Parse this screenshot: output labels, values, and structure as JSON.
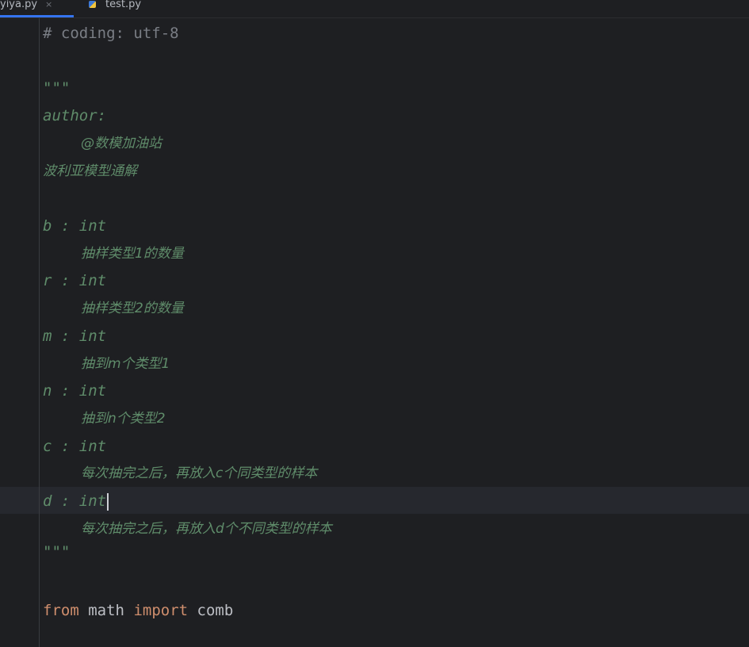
{
  "tabs": [
    {
      "label": "yiya.py",
      "active": true,
      "close": "×"
    },
    {
      "label": "test.py",
      "active": false
    }
  ],
  "editor": {
    "lines": {
      "coding": "# coding: utf-8",
      "doc_open": "\"\"\"",
      "author": "author:",
      "author_name": "@数模加油站",
      "title_zh": "波利亚模型通解",
      "b_decl": "b : int",
      "b_desc": "抽样类型1的数量",
      "r_decl": "r : int",
      "r_desc": "抽样类型2的数量",
      "m_decl": "m : int",
      "m_desc": "抽到m个类型1",
      "n_decl": "n : int",
      "n_desc": "抽到n个类型2",
      "c_decl": "c : int",
      "c_desc": "每次抽完之后，再放入c个同类型的样本",
      "d_decl": "d : int",
      "d_desc": "每次抽完之后，再放入d个不同类型的样本",
      "doc_close": "\"\"\"",
      "import_from": "from",
      "import_module": "math",
      "import_kw": "import",
      "import_name": "comb"
    }
  },
  "colors": {
    "background": "#1e1f22",
    "docstring": "#5f8c6a",
    "comment": "#7a7e85",
    "keyword": "#cf8e6d",
    "identifier": "#bcbec4",
    "caret_row": "#26282e",
    "tab_underline": "#3574f0"
  }
}
